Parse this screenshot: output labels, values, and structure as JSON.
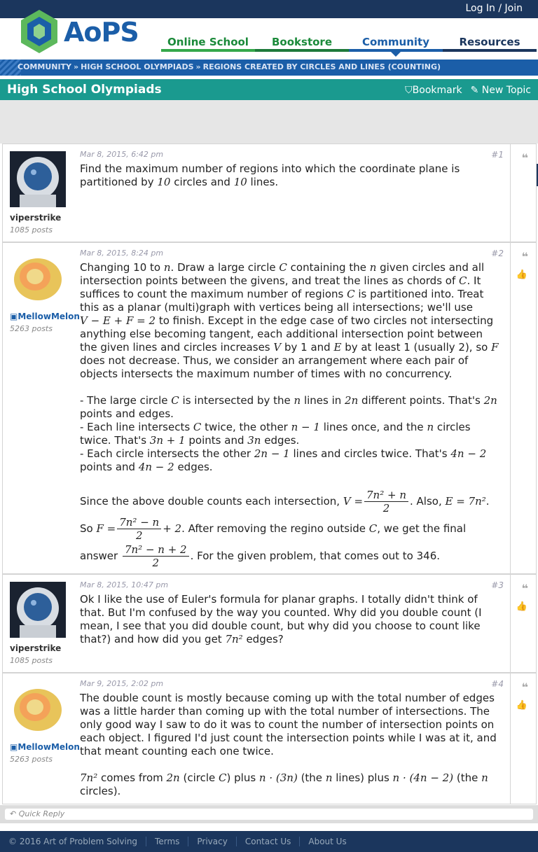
{
  "header": {
    "login_label": "Log In / Join",
    "logo_text": "AoPS"
  },
  "nav": {
    "tabs": [
      "Online School",
      "Bookstore",
      "Community",
      "Resources"
    ]
  },
  "breadcrumb": {
    "items": [
      "COMMUNITY",
      "HIGH SCHOOL OLYMPIADS",
      "REGIONS CREATED BY CIRCLES AND LINES (COUNTING)"
    ],
    "separator": "»"
  },
  "forum": {
    "title": "High School Olympiads",
    "bookmark_label": "Bookmark",
    "new_topic_label": "New Topic"
  },
  "posts": [
    {
      "user": "viperstrike",
      "posts": "1085 posts",
      "date": "Mar 8, 2015, 6:42 pm",
      "number": "#1"
    },
    {
      "user": "MellowMelon",
      "posts": "5263 posts",
      "date": "Mar 8, 2015, 8:24 pm",
      "number": "#2"
    },
    {
      "user": "viperstrike",
      "posts": "1085 posts",
      "date": "Mar 8, 2015, 10:47 pm",
      "number": "#3"
    },
    {
      "user": "MellowMelon",
      "posts": "5263 posts",
      "date": "Mar 9, 2015, 2:02 pm",
      "number": "#4"
    }
  ],
  "quick_reply": "Quick Reply",
  "footer": {
    "copyright": "© 2016 Art of Problem Solving",
    "links": [
      "Terms",
      "Privacy",
      "Contact Us",
      "About Us"
    ]
  },
  "colors": {
    "navy": "#1b365d",
    "blue": "#1b5ea8",
    "teal": "#1a9a8f",
    "green": "#1b8a3a"
  }
}
